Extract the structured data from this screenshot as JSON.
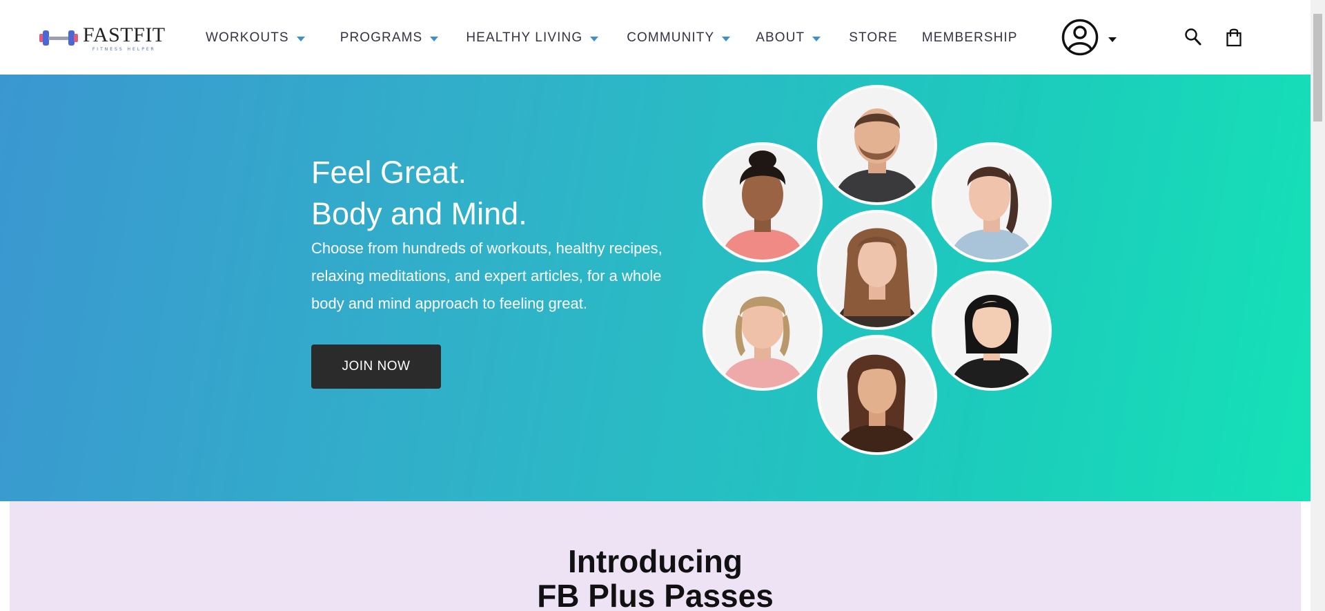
{
  "header": {
    "logo_text": "FASTFIT",
    "logo_subtext": "FITNESS HELPER",
    "nav": [
      {
        "label": "WORKOUTS",
        "dropdown": true
      },
      {
        "label": "PROGRAMS",
        "dropdown": true
      },
      {
        "label": "HEALTHY LIVING",
        "dropdown": true
      },
      {
        "label": "COMMUNITY",
        "dropdown": true
      },
      {
        "label": "ABOUT",
        "dropdown": true
      },
      {
        "label": "STORE",
        "dropdown": false
      },
      {
        "label": "MEMBERSHIP",
        "dropdown": false
      }
    ],
    "icons": [
      "dumbbell-icon",
      "user-account-icon",
      "chevron-down-icon",
      "search-icon",
      "shopping-bag-icon"
    ]
  },
  "hero": {
    "title_line1": "Feel Great.",
    "title_line2": "Body and Mind.",
    "description": "Choose from hundreds of workouts, healthy recipes, relaxing meditations, and expert articles, for a whole body and mind approach to feeling great.",
    "cta_label": "JOIN NOW",
    "gradient_colors": [
      "#3b97d0",
      "#15e2b6"
    ]
  },
  "intro": {
    "title_line1": "Introducing",
    "title_line2": "FB Plus Passes"
  },
  "colors": {
    "accent_caret": "#3b8fd3",
    "button_bg": "#2b2b2b",
    "intro_bg": "#ede3f5"
  }
}
